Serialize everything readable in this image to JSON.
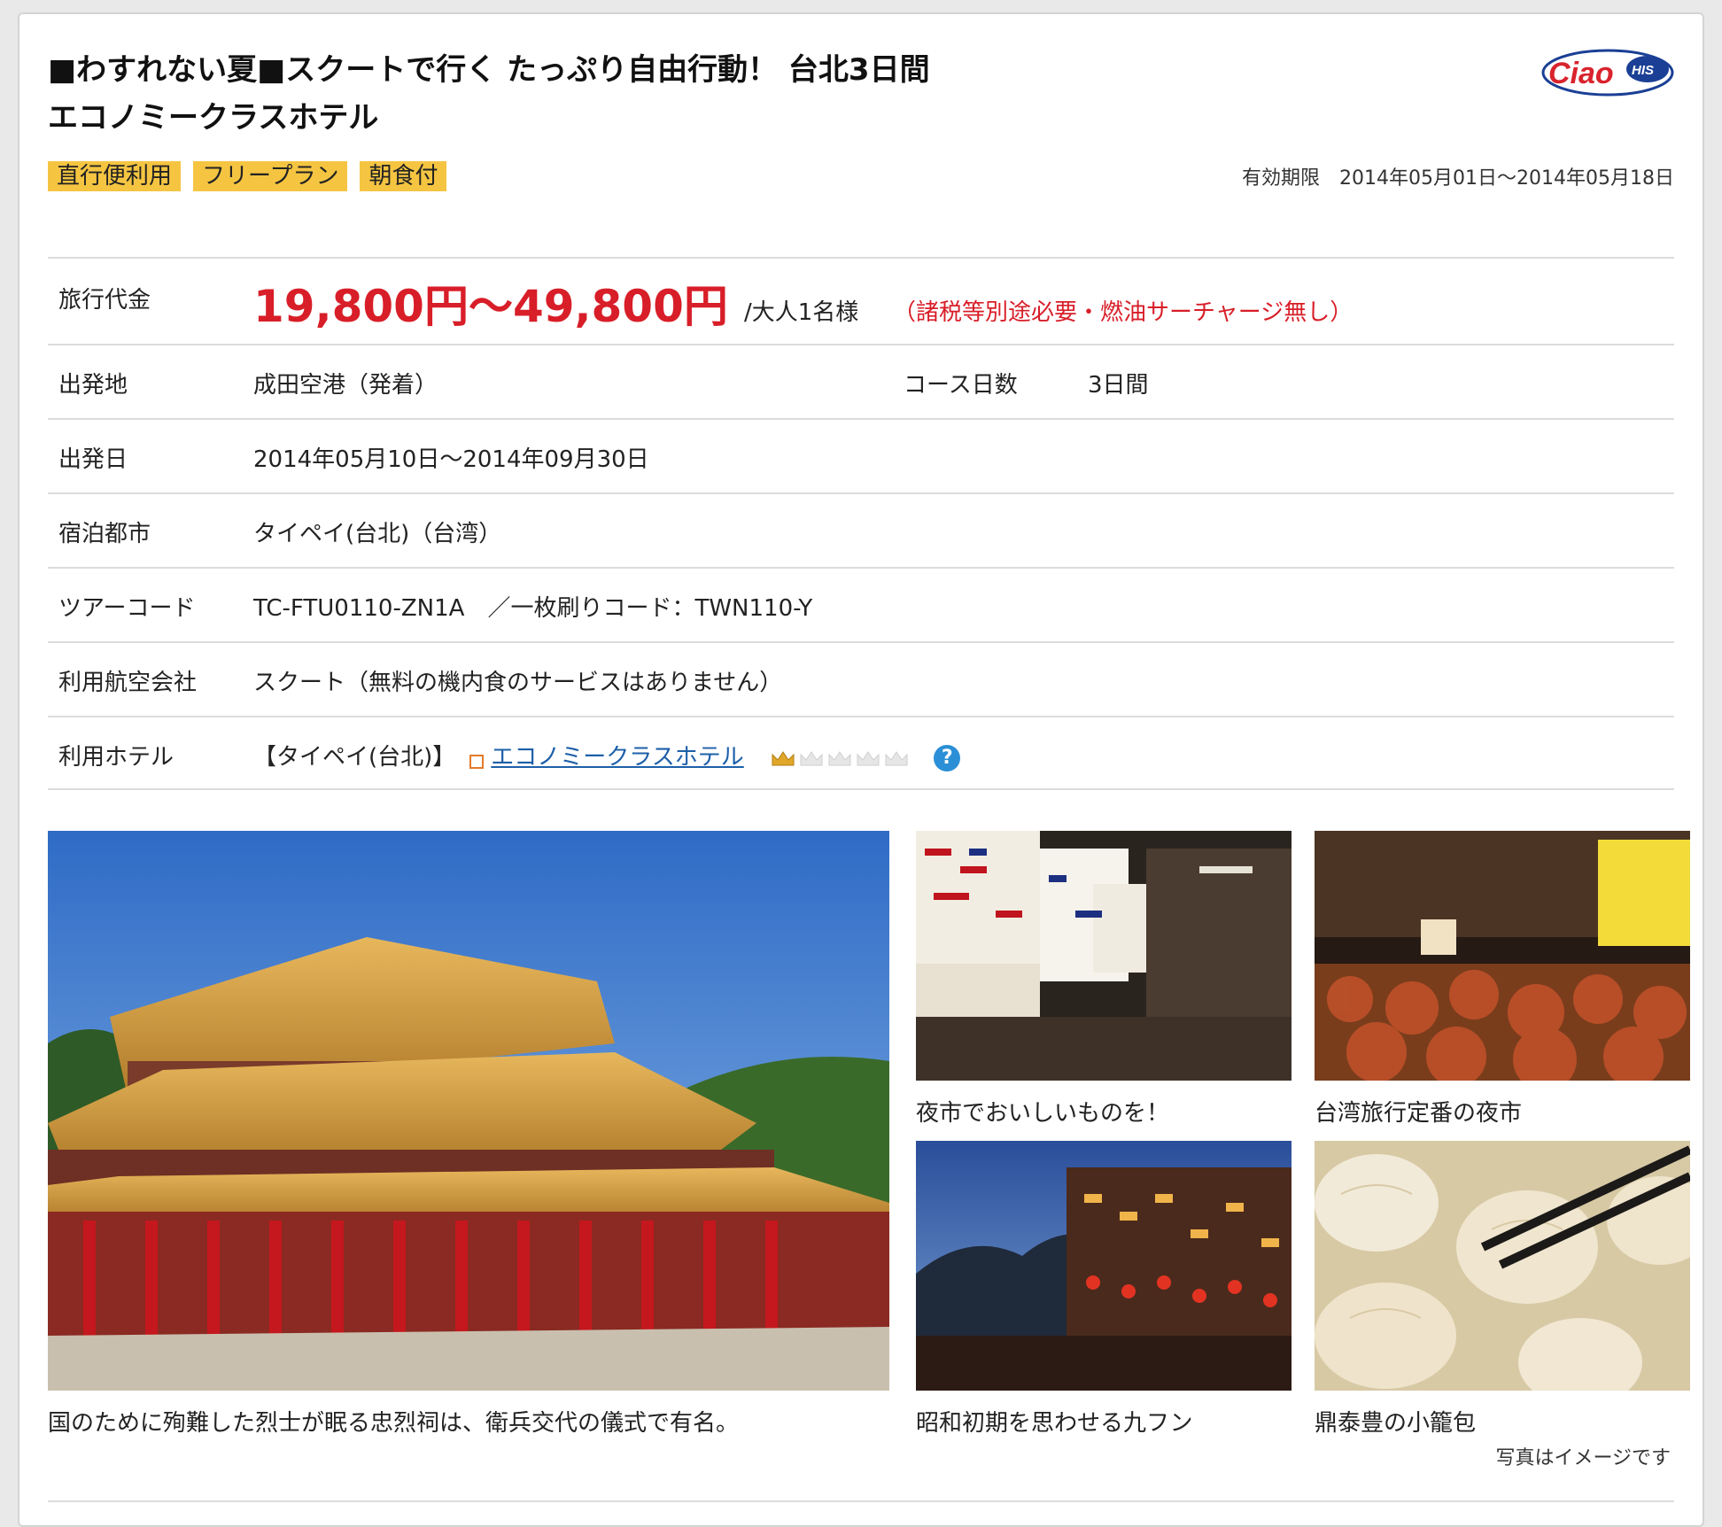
{
  "header": {
    "title_line1": "■わすれない夏■スクートで行く たっぷり自由行動！ 台北3日間",
    "title_line2": "エコノミークラスホテル",
    "logo_text": "Ciao",
    "logo_badge": "HIS",
    "tags": [
      "直行便利用",
      "フリープラン",
      "朝食付"
    ],
    "validity": "有効期限　2014年05月01日～2014年05月18日"
  },
  "details": {
    "price_label": "旅行代金",
    "price": "19,800円～49,800円",
    "price_per": "/大人1名様",
    "price_note": "（諸税等別途必要・燃油サーチャージ無し）",
    "departure_label": "出発地",
    "departure": "成田空港（発着）",
    "days_label": "コース日数",
    "days": "3日間",
    "date_label": "出発日",
    "date": "2014年05月10日～2014年09月30日",
    "city_label": "宿泊都市",
    "city": "タイペイ(台北)（台湾）",
    "code_label": "ツアーコード",
    "code": "TC-FTU0110-ZN1A　／一枚刷りコード：TWN110-Y",
    "airline_label": "利用航空会社",
    "airline": "スクート（無料の機内食のサービスはありません）",
    "hotel_label": "利用ホテル",
    "hotel_city": "【タイペイ(台北)】",
    "hotel_name": "エコノミークラスホテル",
    "hotel_rating": 1,
    "hotel_rating_max": 5,
    "help_label": "?"
  },
  "gallery": {
    "main_caption": "国のために殉難した烈士が眠る忠烈祠は、衛兵交代の儀式で有名。",
    "cap1": "夜市でおいしいものを！",
    "cap2": "台湾旅行定番の夜市",
    "cap3": "昭和初期を思わせる九フン",
    "cap4": "鼎泰豊の小籠包",
    "note": "写真はイメージです"
  },
  "colors": {
    "accent_red": "#d81e28",
    "tag_yellow": "#f5c542",
    "link_blue": "#1d5fa8"
  }
}
